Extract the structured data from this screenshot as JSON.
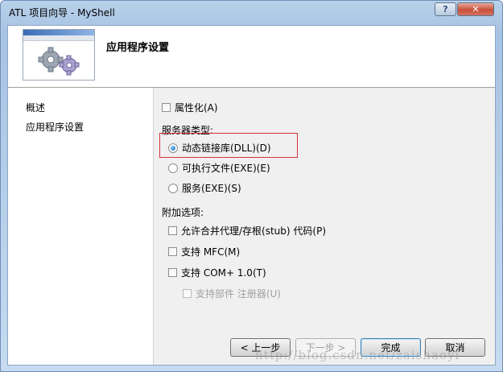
{
  "window": {
    "title": "ATL 项目向导 - MyShell",
    "help_label": "?",
    "close_label": "✕"
  },
  "header": {
    "title": "应用程序设置",
    "icon": "gears-icon"
  },
  "nav": {
    "items": [
      {
        "label": "概述"
      },
      {
        "label": "应用程序设置"
      }
    ]
  },
  "options": {
    "attributed": {
      "label": "属性化(A)",
      "checked": false
    },
    "server_type_label": "服务器类型:",
    "server_types": [
      {
        "label": "动态链接库(DLL)(D)",
        "checked": true
      },
      {
        "label": "可执行文件(EXE)(E)",
        "checked": false
      },
      {
        "label": "服务(EXE)(S)",
        "checked": false
      }
    ],
    "additional_label": "附加选项:",
    "additional": [
      {
        "label": "允许合并代理/存根(stub) 代码(P)",
        "checked": false,
        "enabled": true
      },
      {
        "label": "支持 MFC(M)",
        "checked": false,
        "enabled": true
      },
      {
        "label": "支持 COM+ 1.0(T)",
        "checked": false,
        "enabled": true
      },
      {
        "label": "支持部件 注册器(U)",
        "checked": false,
        "enabled": false
      }
    ]
  },
  "buttons": {
    "prev": "< 上一步",
    "next": "下一步 >",
    "finish": "完成",
    "cancel": "取消"
  },
  "watermark": "http://blog.csdn.net/zaishaoyi",
  "colors": {
    "highlight_box": "#d8303c",
    "title_bar": "#b9d1ea",
    "radio_dot": "#1b6fc1"
  }
}
